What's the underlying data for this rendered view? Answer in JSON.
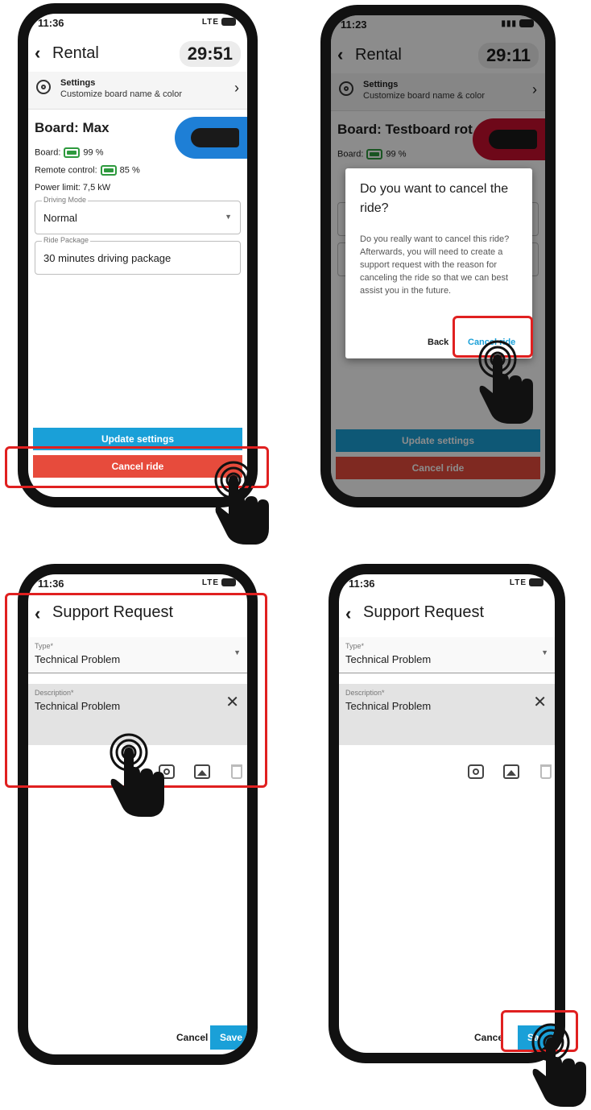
{
  "colors": {
    "accent": "#1aa0d8",
    "danger": "#e74b3c",
    "highlight": "#e02020",
    "battery": "#2e9a3e"
  },
  "panel1": {
    "time": "11:36",
    "signal": "LTE",
    "title": "Rental",
    "timer": "29:51",
    "settings_title": "Settings",
    "settings_sub": "Customize board name & color",
    "board_name": "Board: Max",
    "board_label": "Board:",
    "board_pct": "99 %",
    "remote_label": "Remote control:",
    "remote_pct": "85 %",
    "power": "Power limit: 7,5 kW",
    "driving_label": "Driving Mode",
    "driving_value": "Normal",
    "package_label": "Ride Package",
    "package_value": "30 minutes driving package",
    "update_btn": "Update settings",
    "cancel_btn": "Cancel ride",
    "board_color": "#1e7fd6"
  },
  "panel2": {
    "time": "11:23",
    "title": "Rental",
    "timer": "29:11",
    "settings_title": "Settings",
    "settings_sub": "Customize board name & color",
    "board_name": "Board: Testboard rot",
    "board_label": "Board:",
    "board_pct": "99 %",
    "dialog_title": "Do you want to cancel the ride?",
    "dialog_body": "Do you really want to cancel this ride? Afterwards, you will need to create a support request with the reason for canceling the ride so that we can best assist you in the future.",
    "back_btn": "Back",
    "confirm_btn": "Cancel ride",
    "update_btn": "Update settings",
    "cancel_btn": "Cancel ride",
    "board_color": "#c8102e"
  },
  "panel3": {
    "time": "11:36",
    "signal": "LTE",
    "title": "Support Request",
    "type_label": "Type*",
    "type_value": "Technical Problem",
    "desc_label": "Description*",
    "desc_value": "Technical Problem",
    "cancel_btn": "Cancel",
    "save_btn": "Save"
  },
  "panel4": {
    "time": "11:36",
    "signal": "LTE",
    "title": "Support Request",
    "type_label": "Type*",
    "type_value": "Technical Problem",
    "desc_label": "Description*",
    "desc_value": "Technical Problem",
    "cancel_btn": "Cance",
    "save_btn": "Sa"
  }
}
